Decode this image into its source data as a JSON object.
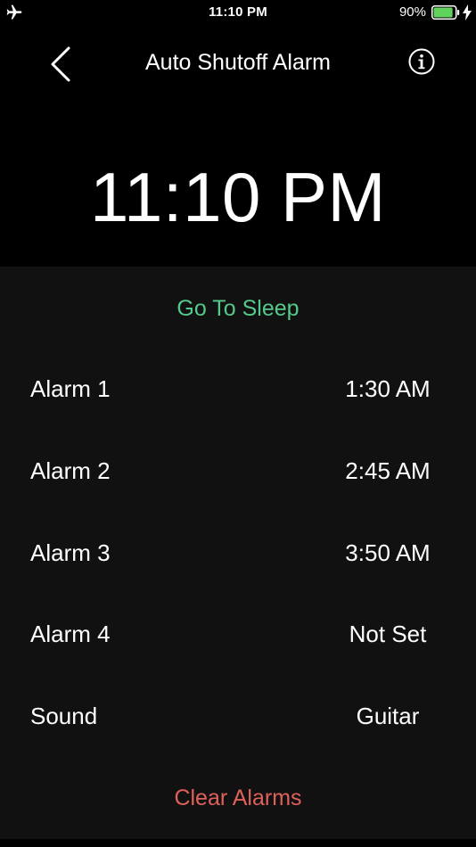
{
  "status_bar": {
    "time": "11:10 PM",
    "battery_percent": "90%",
    "battery_level": 0.9,
    "icons": [
      "airplane-icon",
      "battery-icon",
      "charging-bolt-icon"
    ]
  },
  "nav": {
    "title": "Auto Shutoff Alarm",
    "back_icon": "chevron-left-icon",
    "info_icon": "info-circle-icon"
  },
  "current_time": "11:10 PM",
  "actions": {
    "go_to_sleep": "Go To Sleep",
    "clear_alarms": "Clear Alarms"
  },
  "rows": [
    {
      "label": "Alarm 1",
      "value": "1:30 AM"
    },
    {
      "label": "Alarm 2",
      "value": "2:45 AM"
    },
    {
      "label": "Alarm 3",
      "value": "3:50 AM"
    },
    {
      "label": "Alarm 4",
      "value": "Not Set"
    },
    {
      "label": "Sound",
      "value": "Guitar"
    }
  ],
  "colors": {
    "background": "#000000",
    "panel": "#111111",
    "accent_green": "#54c98b",
    "accent_red": "#e0605a",
    "battery_green": "#5fd35a"
  }
}
